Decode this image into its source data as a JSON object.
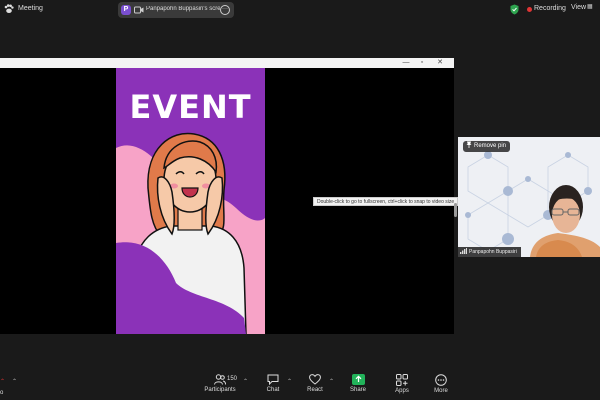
{
  "topbar": {
    "app_title": "Meeting",
    "share_avatar_letter": "P",
    "share_label": "Panpapohn Buppasiri's scree",
    "recording_label": "Recording",
    "view_label": "View"
  },
  "shared_window": {
    "tooltip": "Double-click to go to fullscreen, ctrl+click to snap to video size",
    "poster_title": "EVENT"
  },
  "video": {
    "remove_pin_label": "Remove pin",
    "participant_name": "Panpapohn Buppasiri"
  },
  "toolbar": {
    "left_stub_label": "o",
    "participants_label": "Participants",
    "participants_count": "150",
    "chat_label": "Chat",
    "react_label": "React",
    "share_label": "Share",
    "apps_label": "Apps",
    "more_label": "More"
  },
  "colors": {
    "poster_background": "#8b32b8",
    "poster_pink": "#f7a3c7",
    "share_green": "#22b35a",
    "recording_red": "#e03535",
    "shield_green": "#2ea44f"
  }
}
